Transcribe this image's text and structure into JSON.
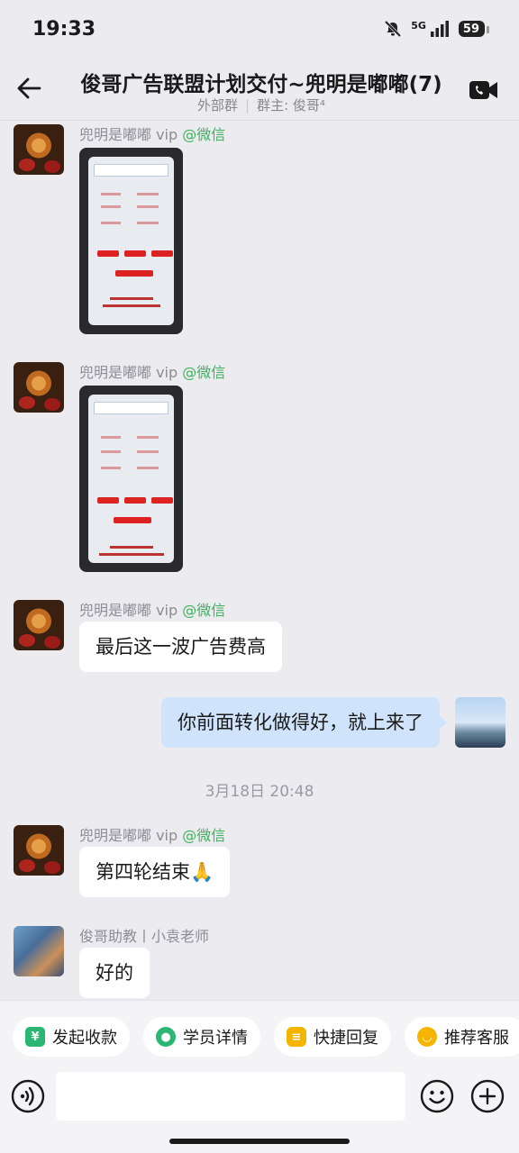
{
  "status_bar": {
    "time": "19:33",
    "network": "5G",
    "battery": "59"
  },
  "header": {
    "title": "俊哥广告联盟计划交付~兜明是嘟嘟(7)",
    "subtitle_type": "外部群",
    "subtitle_owner": "群主: 俊哥⁴"
  },
  "messages": [
    {
      "sender": "兜明是嘟嘟 vip",
      "source": "@微信",
      "type": "image"
    },
    {
      "sender": "兜明是嘟嘟 vip",
      "source": "@微信",
      "type": "image"
    },
    {
      "sender": "兜明是嘟嘟 vip",
      "source": "@微信",
      "text": "最后这一波广告费高"
    },
    {
      "self": true,
      "text": "你前面转化做得好，就上来了"
    },
    {
      "sender": "兜明是嘟嘟 vip",
      "source": "@微信",
      "text": "第四轮结束🙏"
    },
    {
      "sender": "俊哥助教丨小袁老师",
      "text": "好的"
    }
  ],
  "timestamp": "3月18日  20:48",
  "quick_actions": [
    {
      "label": "发起收款",
      "icon": "payment-icon",
      "color": "#2bb673"
    },
    {
      "label": "学员详情",
      "icon": "student-icon",
      "color": "#2bb673"
    },
    {
      "label": "快捷回复",
      "icon": "quick-reply-icon",
      "color": "#f5b400"
    },
    {
      "label": "推荐客服",
      "icon": "recommend-icon",
      "color": "#f5b400"
    }
  ],
  "input": {
    "placeholder": ""
  }
}
